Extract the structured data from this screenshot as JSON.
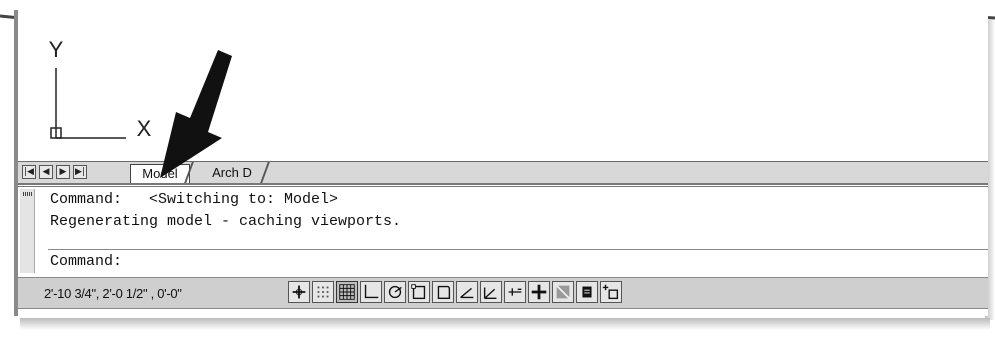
{
  "ucs": {
    "x_label": "X",
    "y_label": "Y"
  },
  "layout_tabs": {
    "nav": [
      "first-icon",
      "prev-icon",
      "next-icon",
      "last-icon"
    ],
    "model": "Model",
    "arch": "Arch D"
  },
  "command_history": [
    "Command:   <Switching to: Model>",
    "Regenerating model - caching viewports."
  ],
  "command_prompt": "Command:",
  "status": {
    "coordinates": "2'-10 3/4\",  2'-0 1/2\"  , 0'-0\"",
    "buttons": [
      {
        "name": "infer-constraints-icon",
        "on": false
      },
      {
        "name": "snap-mode-icon",
        "on": false
      },
      {
        "name": "grid-display-icon",
        "on": true
      },
      {
        "name": "ortho-mode-icon",
        "on": false
      },
      {
        "name": "polar-tracking-icon",
        "on": false
      },
      {
        "name": "object-snap-icon",
        "on": false
      },
      {
        "name": "3d-object-snap-icon",
        "on": false
      },
      {
        "name": "object-snap-tracking-icon",
        "on": false
      },
      {
        "name": "dynamic-ucs-icon",
        "on": false
      },
      {
        "name": "dynamic-input-icon",
        "on": false
      },
      {
        "name": "lineweight-icon",
        "on": false
      },
      {
        "name": "transparency-icon",
        "on": false
      },
      {
        "name": "quick-properties-icon",
        "on": false
      },
      {
        "name": "selection-cycling-icon",
        "on": false
      }
    ]
  }
}
